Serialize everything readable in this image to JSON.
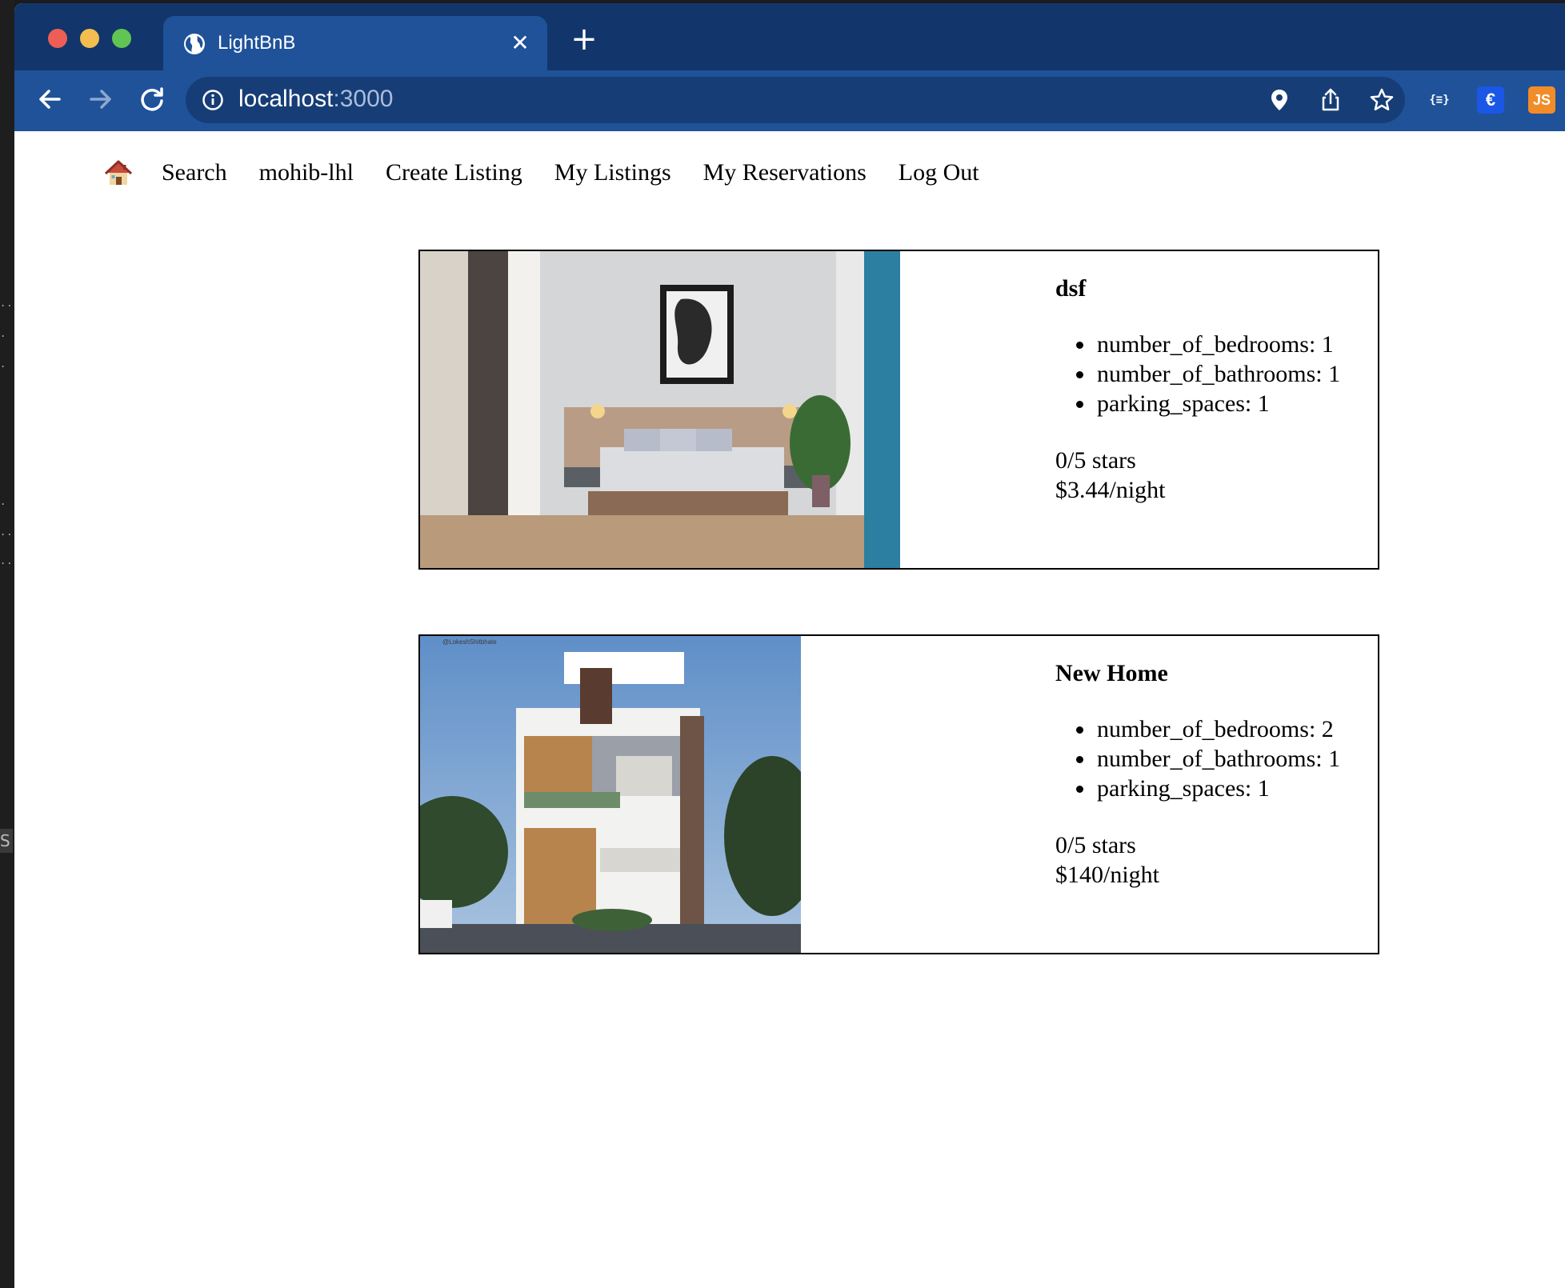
{
  "browser": {
    "tab_title": "LightBnB",
    "new_tab_label": "+",
    "close_tab_label": "✕",
    "url_host": "localhost",
    "url_port": ":3000",
    "extensions": {
      "json_label": "{≡}",
      "euro_label": "€",
      "js_label": "JS"
    },
    "colors": {
      "titlebar": "#12366b",
      "toolbar": "#1f5299",
      "omnibox": "#163d76"
    }
  },
  "site_nav": {
    "home_icon": "house-icon",
    "links": [
      "Search",
      "mohib-lhl",
      "Create Listing",
      "My Listings",
      "My Reservations",
      "Log Out"
    ]
  },
  "listings": [
    {
      "title": "dsf",
      "features": [
        "number_of_bedrooms: 1",
        "number_of_bathrooms: 1",
        "parking_spaces: 1"
      ],
      "rating": "0/5 stars",
      "price": "$3.44/night",
      "photo": "bedroom-photo"
    },
    {
      "title": "New Home",
      "features": [
        "number_of_bedrooms: 2",
        "number_of_bathrooms: 1",
        "parking_spaces: 1"
      ],
      "rating": "0/5 stars",
      "price": "$140/night",
      "photo": "house-exterior-photo",
      "photo_caption": "@LokeshShitbhate"
    }
  ]
}
